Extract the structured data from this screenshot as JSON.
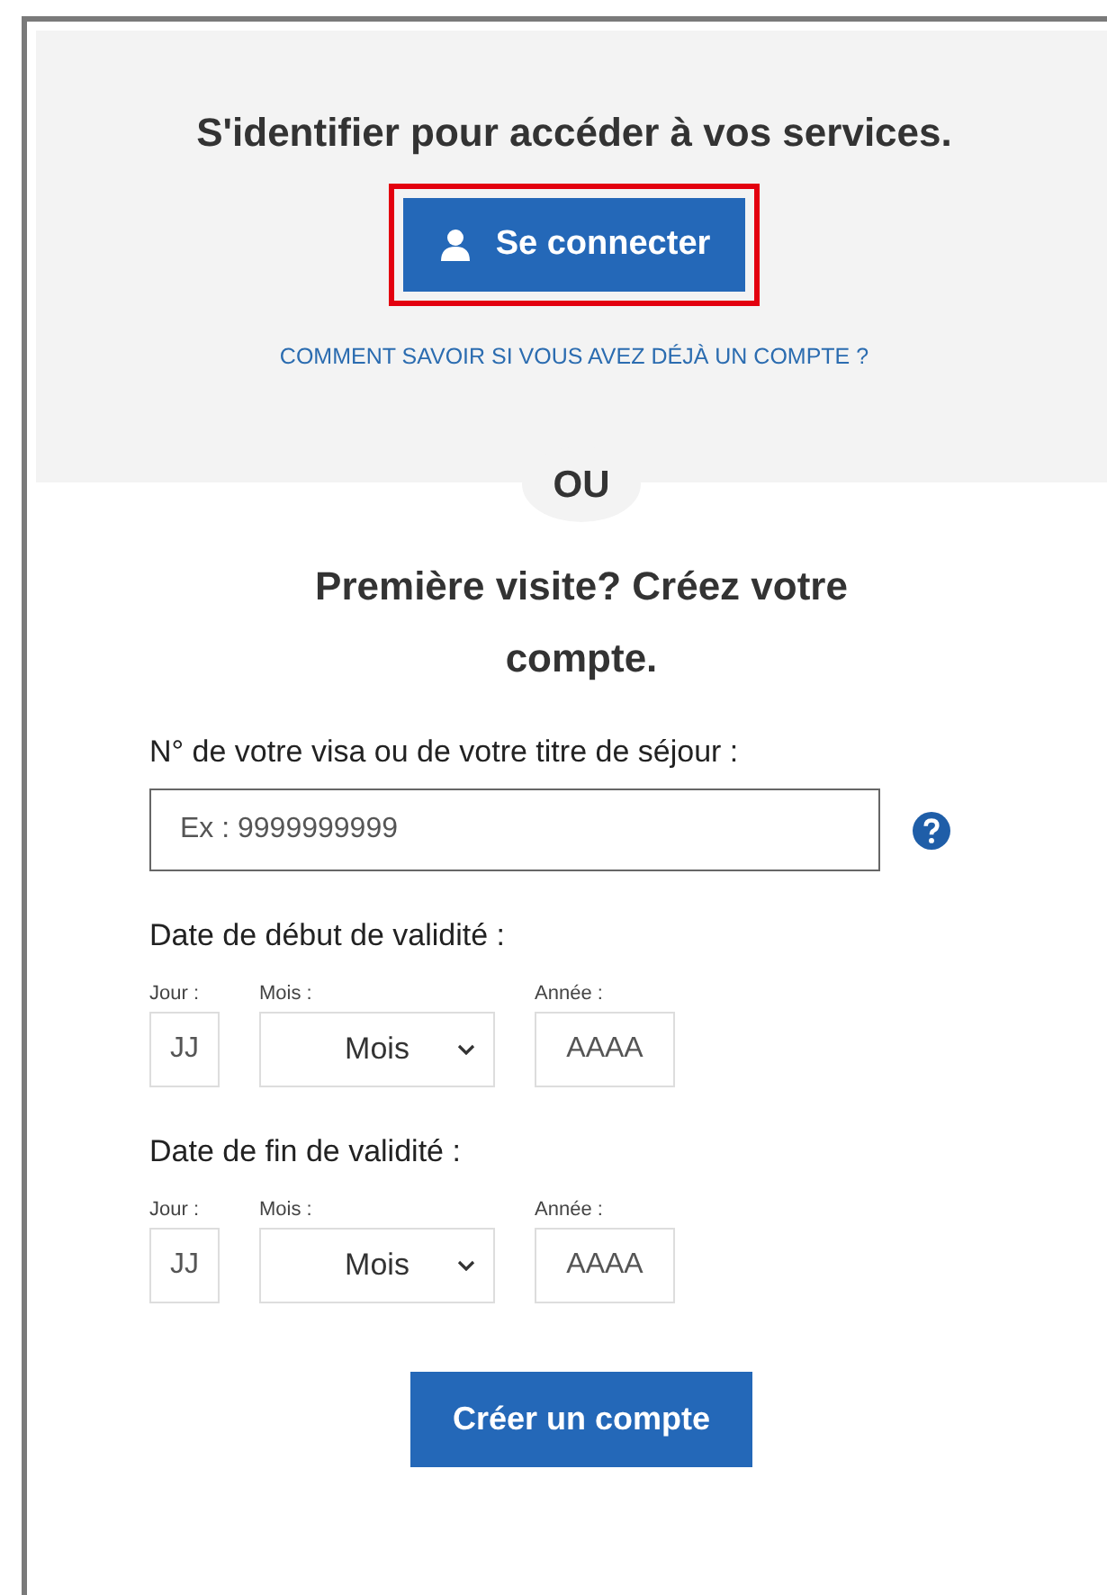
{
  "login": {
    "heading": "S'identifier pour accéder à vos services.",
    "button": {
      "label": "Se connecter",
      "highlighted": true
    },
    "help_link": "COMMENT SAVOIR SI VOUS AVEZ DÉJÀ UN COMPTE ?"
  },
  "separator": "OU",
  "signup": {
    "heading": "Première visite? Créez votre compte.",
    "visa_field": {
      "label": "N° de votre visa ou de votre titre de séjour :",
      "placeholder": "Ex : 9999999999"
    },
    "dates": [
      {
        "label": "Date de début de validité :",
        "day_label": "Jour :",
        "day_placeholder": "JJ",
        "month_label": "Mois :",
        "month_value": "Mois",
        "year_label": "Année :",
        "year_placeholder": "AAAA"
      },
      {
        "label": "Date de fin de validité :",
        "day_label": "Jour :",
        "day_placeholder": "JJ",
        "month_label": "Mois :",
        "month_value": "Mois",
        "year_label": "Année :",
        "year_placeholder": "AAAA"
      }
    ],
    "submit": "Créer un compte"
  }
}
